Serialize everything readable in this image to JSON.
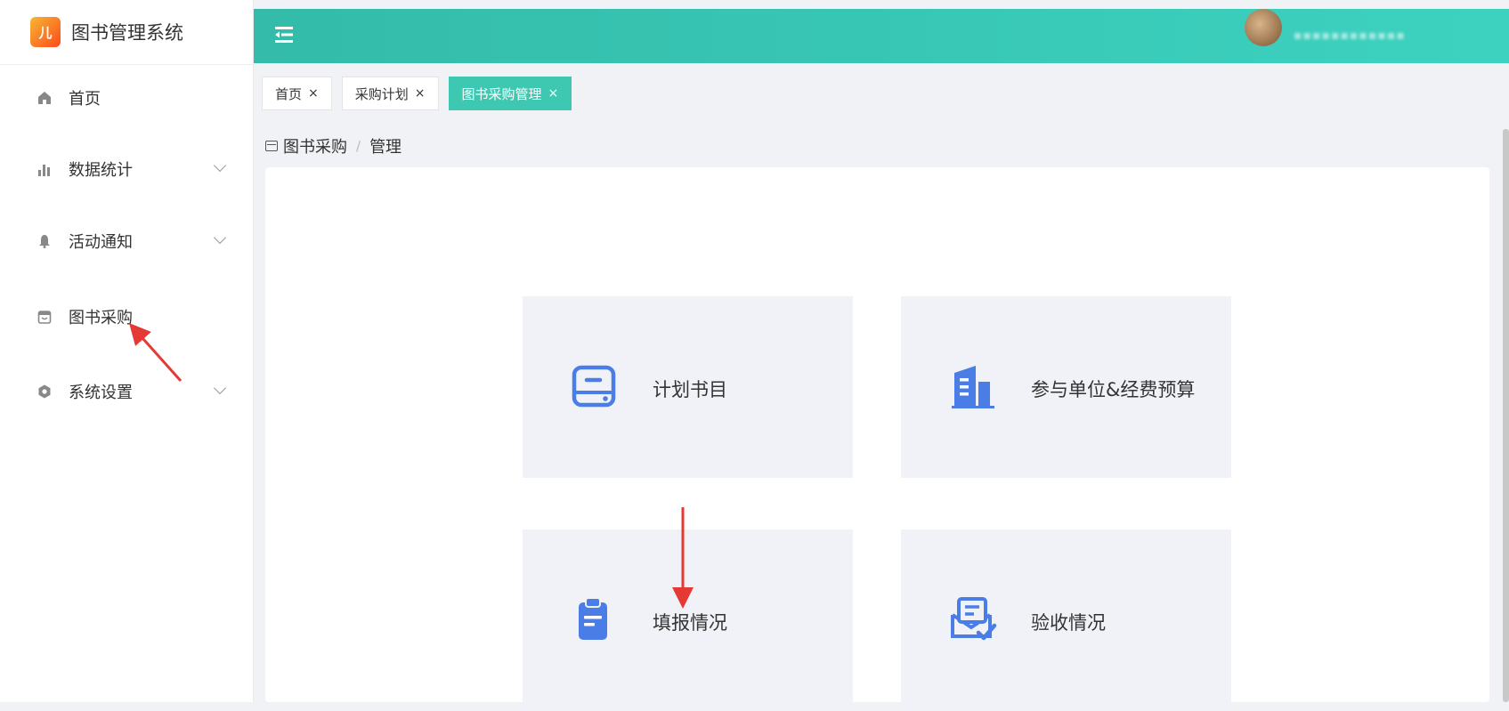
{
  "app": {
    "title": "图书管理系统",
    "logo_text": "儿"
  },
  "sidebar": {
    "items": [
      {
        "label": "首页",
        "icon": "home-icon",
        "has_submenu": false
      },
      {
        "label": "数据统计",
        "icon": "bar-chart-icon",
        "has_submenu": true
      },
      {
        "label": "活动通知",
        "icon": "bell-icon",
        "has_submenu": true
      },
      {
        "label": "图书采购",
        "icon": "shopping-bag-icon",
        "has_submenu": false
      },
      {
        "label": "系统设置",
        "icon": "settings-icon",
        "has_submenu": true
      }
    ]
  },
  "header": {
    "username": "▪▪▪▪▪▪▪▪▪▪▪▪"
  },
  "tabs": [
    {
      "label": "首页",
      "active": false
    },
    {
      "label": "采购计划",
      "active": false
    },
    {
      "label": "图书采购管理",
      "active": true
    }
  ],
  "breadcrumb": {
    "parent": "图书采购",
    "current": "管理",
    "separator": "/"
  },
  "cards": [
    {
      "label": "计划书目",
      "icon": "hard-drive-icon"
    },
    {
      "label": "参与单位&经费预算",
      "icon": "building-icon"
    },
    {
      "label": "填报情况",
      "icon": "clipboard-icon"
    },
    {
      "label": "验收情况",
      "icon": "checked-document-icon"
    }
  ],
  "colors": {
    "primary": "#3fc8b1",
    "header_start": "#34bba9",
    "header_end": "#3dd2c0",
    "icon_blue": "#4a7ee6",
    "annotation_red": "#e53935"
  }
}
